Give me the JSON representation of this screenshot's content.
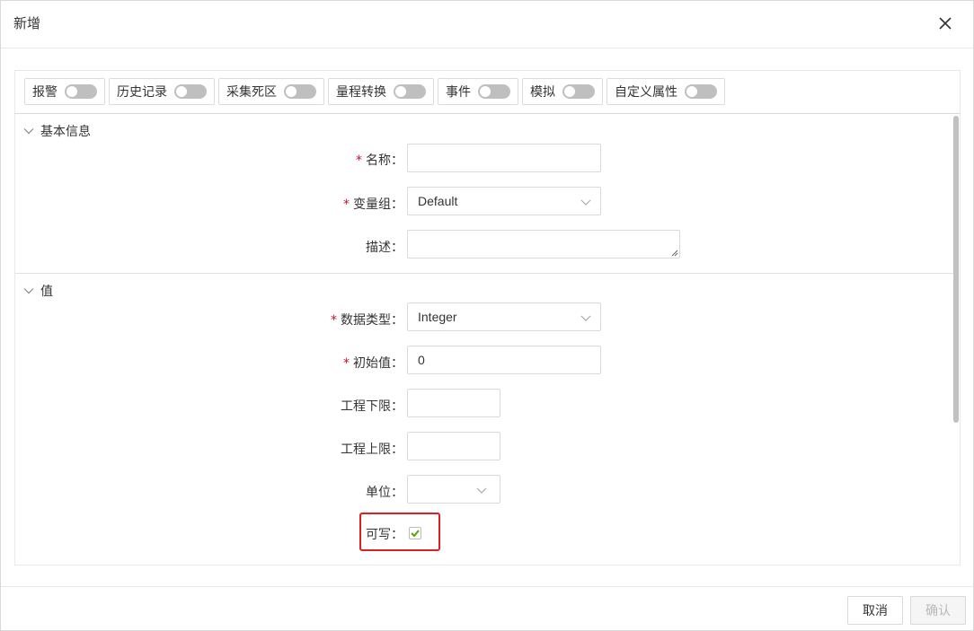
{
  "dialog": {
    "title": "新增"
  },
  "toolbar": {
    "toggles": [
      {
        "label": "报警",
        "on": false
      },
      {
        "label": "历史记录",
        "on": false
      },
      {
        "label": "采集死区",
        "on": false
      },
      {
        "label": "量程转换",
        "on": false
      },
      {
        "label": "事件",
        "on": false
      },
      {
        "label": "模拟",
        "on": false
      },
      {
        "label": "自定义属性",
        "on": false
      }
    ]
  },
  "sections": {
    "basic": {
      "title": "基本信息",
      "name_label": "名称：",
      "name_value": "",
      "group_label": "变量组：",
      "group_value": "Default",
      "desc_label": "描述：",
      "desc_value": ""
    },
    "value": {
      "title": "值",
      "datatype_label": "数据类型：",
      "datatype_value": "Integer",
      "init_label": "初始值：",
      "init_value": "0",
      "eng_low_label": "工程下限：",
      "eng_low_value": "",
      "eng_high_label": "工程上限：",
      "eng_high_value": "",
      "unit_label": "单位：",
      "unit_value": "",
      "writable_label": "可写：",
      "writable_checked": true
    }
  },
  "required_mark": "*",
  "footer": {
    "cancel": "取消",
    "confirm": "确认"
  },
  "colors": {
    "required": "#c8102e",
    "highlight": "#e02020",
    "check": "#52a800"
  }
}
